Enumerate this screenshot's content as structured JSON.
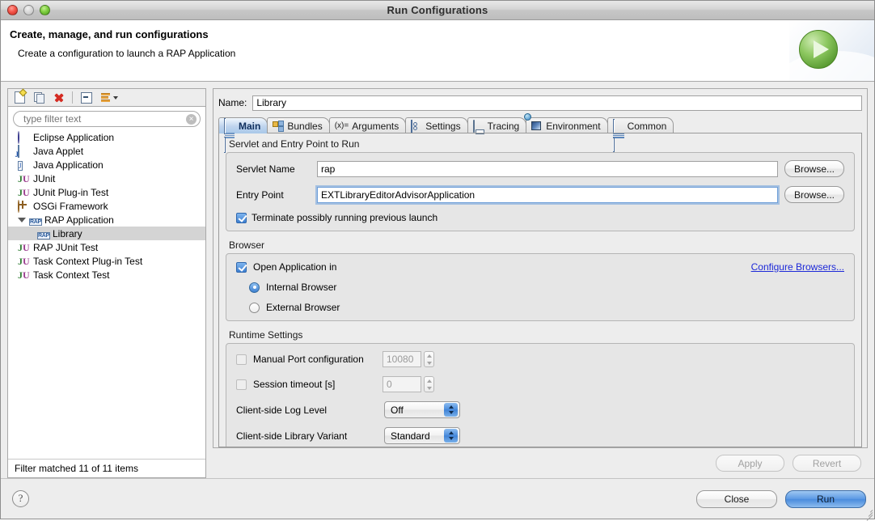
{
  "window": {
    "title": "Run Configurations",
    "traffic_lights": [
      "close",
      "minimize",
      "zoom"
    ]
  },
  "banner": {
    "title": "Create, manage, and run configurations",
    "subtitle": "Create a configuration to launch a RAP Application",
    "icon": "run-green-play-icon"
  },
  "left_panel": {
    "toolbar": [
      {
        "name": "new-configuration",
        "icon": "new-page-icon"
      },
      {
        "name": "duplicate-configuration",
        "icon": "copy-pages-icon"
      },
      {
        "name": "delete-configuration",
        "icon": "red-x-delete-icon"
      },
      {
        "name": "collapse-all",
        "icon": "collapse-all-icon"
      },
      {
        "name": "filter-menu",
        "icon": "filter-icon"
      }
    ],
    "filter": {
      "placeholder": "type filter text",
      "value": "",
      "clear_glyph": "×"
    },
    "tree": [
      {
        "label": "Eclipse Application",
        "icon": "eclipse-icon",
        "level": 0,
        "selected": false,
        "expandable": false
      },
      {
        "label": "Java Applet",
        "icon": "java-applet-icon",
        "level": 0,
        "selected": false,
        "expandable": false
      },
      {
        "label": "Java Application",
        "icon": "java-application-icon",
        "level": 0,
        "selected": false,
        "expandable": false
      },
      {
        "label": "JUnit",
        "icon": "junit-icon",
        "level": 0,
        "selected": false,
        "expandable": false
      },
      {
        "label": "JUnit Plug-in Test",
        "icon": "junit-plugin-icon",
        "level": 0,
        "selected": false,
        "expandable": false
      },
      {
        "label": "OSGi Framework",
        "icon": "osgi-icon",
        "level": 0,
        "selected": false,
        "expandable": false
      },
      {
        "label": "RAP Application",
        "icon": "rap-icon",
        "level": 0,
        "selected": false,
        "expandable": true,
        "expanded": true
      },
      {
        "label": "Library",
        "icon": "rap-icon",
        "level": 1,
        "selected": true,
        "expandable": false
      },
      {
        "label": "RAP JUnit Test",
        "icon": "junit-icon",
        "level": 0,
        "selected": false,
        "expandable": false
      },
      {
        "label": "Task Context Plug-in Test",
        "icon": "junit-plugin-icon",
        "level": 0,
        "selected": false,
        "expandable": false
      },
      {
        "label": "Task Context Test",
        "icon": "junit-icon",
        "level": 0,
        "selected": false,
        "expandable": false
      }
    ],
    "status": "Filter matched 11 of 11 items"
  },
  "right_panel": {
    "name_label": "Name:",
    "name_value": "Library",
    "tabs": [
      {
        "label": "Main",
        "icon": "main-tab-icon",
        "active": true
      },
      {
        "label": "Bundles",
        "icon": "bundles-tab-icon",
        "active": false
      },
      {
        "label": "Arguments",
        "icon": "arguments-tab-icon",
        "icon_text": "(x)=",
        "active": false
      },
      {
        "label": "Settings",
        "icon": "settings-tab-icon",
        "active": false
      },
      {
        "label": "Tracing",
        "icon": "tracing-tab-icon",
        "active": false
      },
      {
        "label": "Environment",
        "icon": "environment-tab-icon",
        "active": false
      },
      {
        "label": "Common",
        "icon": "common-tab-icon",
        "active": false
      }
    ],
    "servlet_group": {
      "title": "Servlet and Entry Point to Run",
      "servlet_label": "Servlet Name",
      "servlet_value": "rap",
      "servlet_browse": "Browse...",
      "entry_label": "Entry Point",
      "entry_value": "EXTLibraryEditorAdvisorApplication",
      "entry_browse": "Browse...",
      "terminate_label": "Terminate possibly running previous launch",
      "terminate_checked": true
    },
    "browser_group": {
      "title": "Browser",
      "open_label": "Open Application in",
      "open_checked": true,
      "configure_link": "Configure Browsers...",
      "options": [
        {
          "label": "Internal Browser",
          "selected": true
        },
        {
          "label": "External Browser",
          "selected": false
        }
      ]
    },
    "runtime_group": {
      "title": "Runtime Settings",
      "manual_port_label": "Manual Port configuration",
      "manual_port_checked": false,
      "manual_port_value": "10080",
      "session_timeout_label": "Session timeout [s]",
      "session_timeout_checked": false,
      "session_timeout_value": "0",
      "log_level_label": "Client-side Log Level",
      "log_level_value": "Off",
      "library_variant_label": "Client-side Library Variant",
      "library_variant_value": "Standard"
    },
    "apply_label": "Apply",
    "revert_label": "Revert",
    "apply_enabled": false,
    "revert_enabled": false
  },
  "footer": {
    "help_glyph": "?",
    "close_label": "Close",
    "run_label": "Run"
  }
}
